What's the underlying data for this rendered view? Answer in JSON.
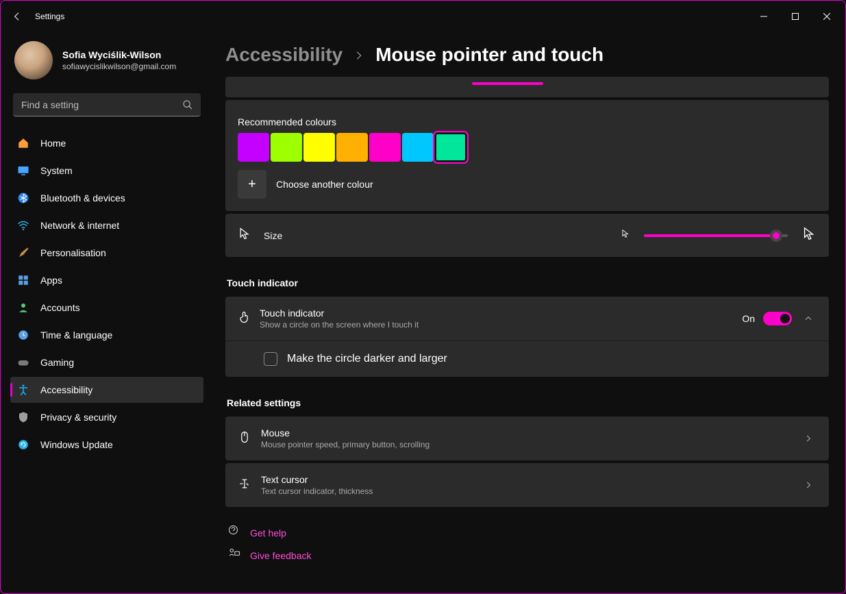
{
  "titlebar": {
    "app_name": "Settings"
  },
  "user": {
    "name": "Sofia Wyciślik-Wilson",
    "email": "sofiawycislikwilson@gmail.com"
  },
  "search": {
    "placeholder": "Find a setting"
  },
  "nav": {
    "home": "Home",
    "system": "System",
    "bluetooth": "Bluetooth & devices",
    "network": "Network & internet",
    "personalisation": "Personalisation",
    "apps": "Apps",
    "accounts": "Accounts",
    "time": "Time & language",
    "gaming": "Gaming",
    "accessibility": "Accessibility",
    "privacy": "Privacy & security",
    "update": "Windows Update"
  },
  "breadcrumb": {
    "parent": "Accessibility",
    "current": "Mouse pointer and touch"
  },
  "colours": {
    "heading": "Recommended colours",
    "swatches": [
      "#c400ff",
      "#9dff00",
      "#ffff00",
      "#ffb000",
      "#ff00c8",
      "#00c8ff",
      "#00e79b"
    ],
    "selected_index": 6,
    "choose_another": "Choose another colour"
  },
  "size": {
    "label": "Size",
    "value_percent": 92
  },
  "touch_section": {
    "heading": "Touch indicator",
    "title": "Touch indicator",
    "desc": "Show a circle on the screen where I touch it",
    "toggle_label": "On",
    "toggle_state": true,
    "checkbox_label": "Make the circle darker and larger",
    "checkbox_checked": false
  },
  "related": {
    "heading": "Related settings",
    "mouse_title": "Mouse",
    "mouse_desc": "Mouse pointer speed, primary button, scrolling",
    "cursor_title": "Text cursor",
    "cursor_desc": "Text cursor indicator, thickness"
  },
  "footer": {
    "help": "Get help",
    "feedback": "Give feedback"
  }
}
